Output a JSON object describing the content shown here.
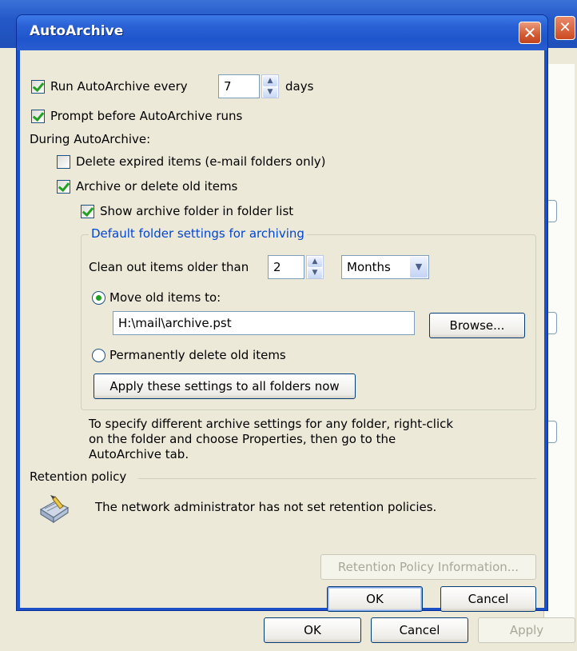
{
  "background_window": {
    "buttons": {
      "ok": "OK",
      "cancel": "Cancel",
      "apply": "Apply"
    },
    "close_glyph": "✕",
    "title_fragment": ""
  },
  "dialog": {
    "title": "AutoArchive",
    "close_glyph": "✕",
    "run_autoarchive": {
      "label": "Run AutoArchive every",
      "checked": true,
      "value": "7",
      "unit": "days"
    },
    "prompt_before": {
      "label": "Prompt before AutoArchive runs",
      "checked": true
    },
    "during_label": "During AutoArchive:",
    "delete_expired": {
      "label": "Delete expired items (e-mail folders only)",
      "checked": false
    },
    "archive_old": {
      "label": "Archive or delete old items",
      "checked": true
    },
    "show_archive_folder": {
      "label": "Show archive folder in folder list",
      "checked": true
    },
    "defaults_group": {
      "label": "Default folder settings for archiving",
      "clean_out_label": "Clean out items older than",
      "clean_out_value": "2",
      "period_value": "Months",
      "move_old": {
        "label": "Move old items to:",
        "selected": true
      },
      "archive_path": "H:\\mail\\archive.pst",
      "browse_label": "Browse...",
      "permanently_delete": {
        "label": "Permanently delete old items",
        "selected": false
      },
      "apply_all_label": "Apply these settings to all folders now"
    },
    "info_text": "To specify different archive settings for any folder, right-click on the folder and choose Properties, then go to the AutoArchive tab.",
    "info_lines": [
      "To specify different archive settings for any folder, right-click",
      "on the folder and choose Properties, then go to the",
      "AutoArchive tab."
    ],
    "retention": {
      "label": "Retention policy",
      "message": "The network administrator has not set retention policies.",
      "info_button": "Retention Policy Information..."
    },
    "ok_label": "OK",
    "cancel_label": "Cancel"
  },
  "colors": {
    "title_bar": "#2a62d6",
    "group_label": "#0046d5",
    "check_mark": "#21a121",
    "dialog_face": "#ece9d8"
  },
  "icons": [
    "close-icon",
    "checkbox-check-icon",
    "spin-up-icon",
    "spin-down-icon",
    "dropdown-arrow-icon",
    "retention-policy-icon"
  ]
}
